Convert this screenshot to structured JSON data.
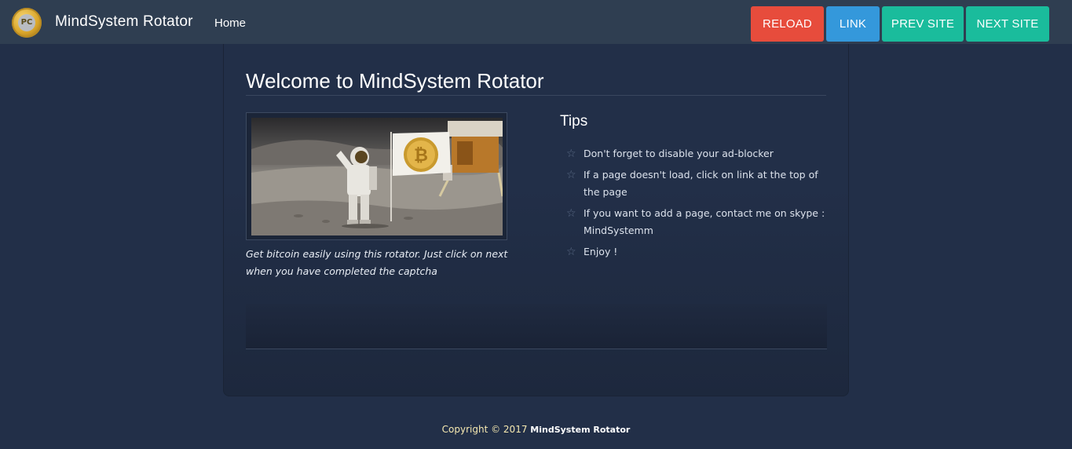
{
  "navbar": {
    "logo_icon": "pc-coin-logo-icon",
    "logo_text": "PC",
    "brand": "MindSystem Rotator",
    "home_label": "Home",
    "buttons": {
      "reload": "RELOAD",
      "link": "LINK",
      "prev": "PREV SITE",
      "next": "NEXT SITE"
    },
    "colors": {
      "reload": "#e74c3c",
      "link": "#3498db",
      "prev": "#1abc9c",
      "next": "#1abc9c"
    }
  },
  "main": {
    "title": "Welcome to MindSystem Rotator",
    "image_alt_icon": "astronaut-bitcoin-flag-image",
    "bitcoin_symbol": "₿",
    "caption": "Get bitcoin easily using this rotator. Just click on next when you have completed the captcha",
    "tips": {
      "title": "Tips",
      "items": [
        "Don't forget to disable your ad-blocker",
        "If a page doesn't load, click on link at the top of the page",
        "If you want to add a page, contact me on skype : MindSystemm",
        "Enjoy !"
      ]
    }
  },
  "footer": {
    "copyright": "Copyright © 2017",
    "brand": "MindSystem Rotator"
  }
}
